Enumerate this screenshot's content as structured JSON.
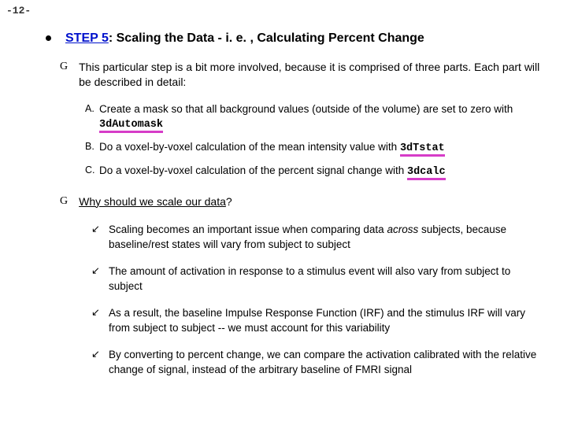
{
  "page_number": "-12-",
  "heading": {
    "step": "STEP 5",
    "rest": ": Scaling the Data - i. e. , Calculating Percent Change"
  },
  "intro": "This particular step is a bit more involved, because it is comprised of three parts. Each part will be described in detail:",
  "steps": {
    "a_pre": "Create a mask so that all background values (outside of the volume) are set to zero with ",
    "a_cmd": "3dAutomask",
    "b_pre": "Do a voxel-by-voxel calculation of the mean intensity value with ",
    "b_cmd": "3dTstat",
    "c_pre": "Do a voxel-by-voxel calculation of the percent signal change with ",
    "c_cmd": "3dcalc"
  },
  "question": "Why should we scale our data",
  "qmark": "?",
  "reasons": {
    "r1a": "Scaling becomes an important issue when comparing data ",
    "r1b": "across",
    "r1c": " subjects, because baseline/rest states will vary from subject to subject",
    "r2": "The amount of activation in response to a stimulus event will also vary from subject to subject",
    "r3": "As a result, the baseline Impulse Response Function (IRF) and the stimulus IRF will vary from subject to subject -- we must account for this variability",
    "r4": "By converting to percent change, we can compare the activation calibrated with the relative change of signal, instead of the arbitrary baseline of FMRI signal"
  },
  "letters": {
    "a": "A.",
    "b": "B.",
    "c": "C."
  },
  "arrow": "↙"
}
